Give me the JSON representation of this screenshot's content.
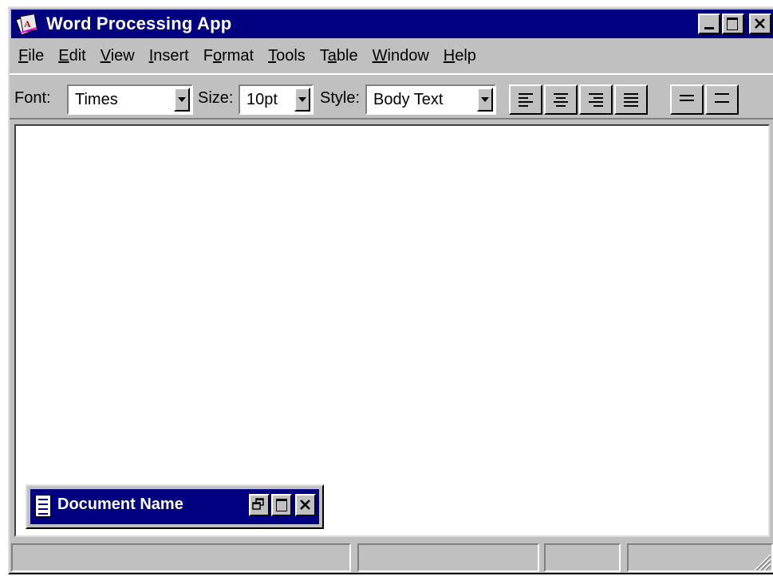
{
  "window": {
    "title": "Word Processing App"
  },
  "menu": [
    {
      "accel": "F",
      "rest": "ile"
    },
    {
      "accel": "E",
      "rest": "dit"
    },
    {
      "accel": "V",
      "rest": "iew"
    },
    {
      "accel": "I",
      "rest": "nsert"
    },
    {
      "pre": "F",
      "accel": "o",
      "rest": "rmat"
    },
    {
      "accel": "T",
      "rest": "ools"
    },
    {
      "pre": "T",
      "accel": "a",
      "rest": "ble"
    },
    {
      "accel": "W",
      "rest": "indow"
    },
    {
      "accel": "H",
      "rest": "elp"
    }
  ],
  "toolbar": {
    "font_label": "Font:",
    "font_value": "Times",
    "size_label": "Size:",
    "size_value": "10pt",
    "style_label": "Style:",
    "style_value": "Body Text",
    "buttons": [
      "align-left-icon",
      "align-center-icon",
      "align-right-icon",
      "justify-icon",
      "single-line-spacing-icon",
      "double-line-spacing-icon"
    ]
  },
  "document": {
    "minimized_title": "Document Name"
  },
  "colors": {
    "titlebar": "#000080",
    "face": "#c0c0c0"
  }
}
